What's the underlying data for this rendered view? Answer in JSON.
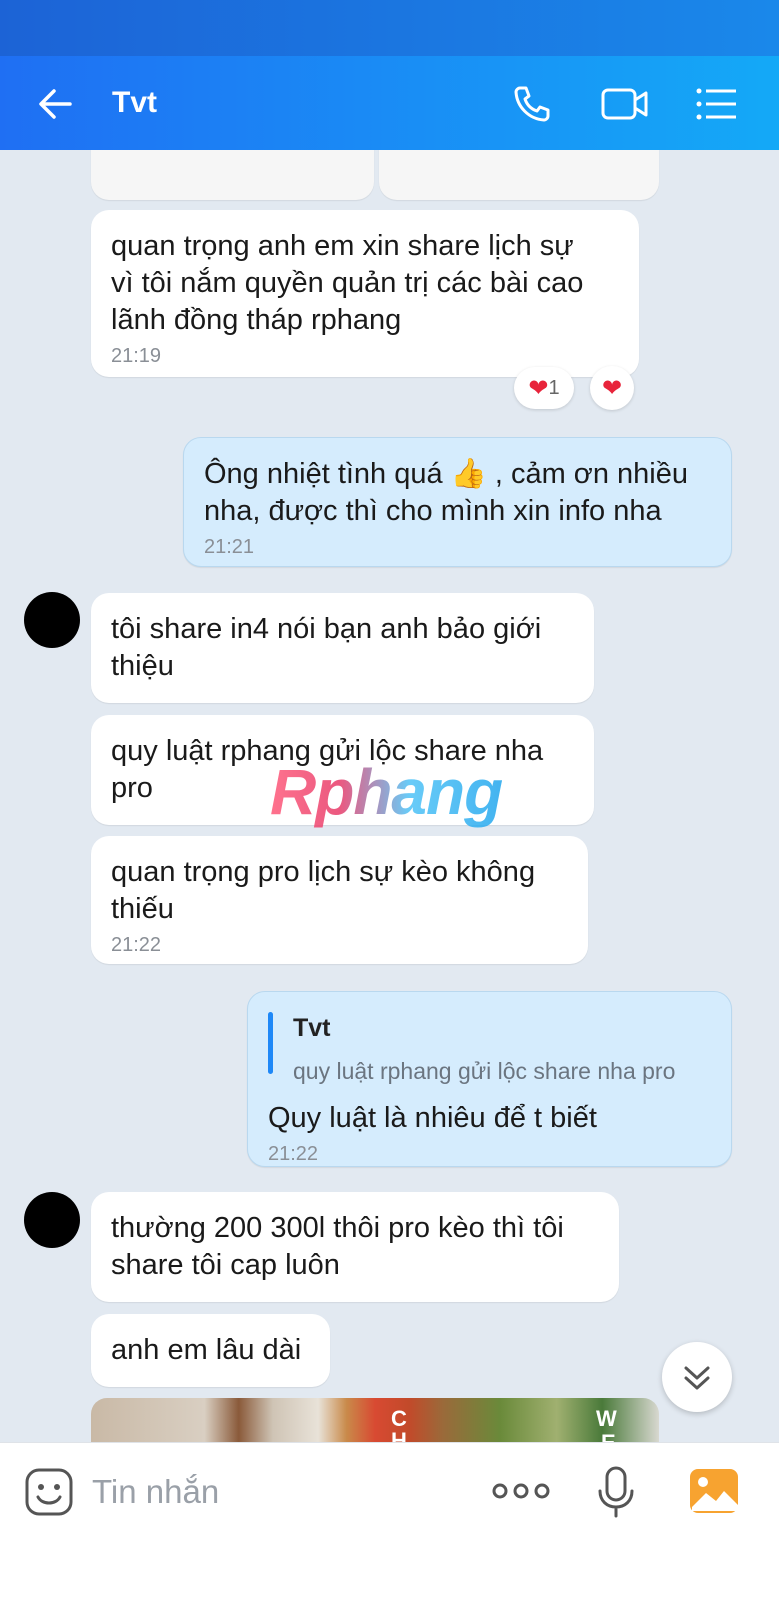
{
  "header": {
    "title": "Tvt"
  },
  "messages": [
    {
      "text": "quan trọng anh em xin share lịch sự\nvì tôi nắm quyền quản trị các bài cao\nlãnh đồng tháp rphang",
      "time": "21:19"
    },
    {
      "text": "Ông nhiệt tình quá 👍 , cảm ơn nhiều\nnha, được thì cho mình xin info nha",
      "time": "21:21"
    },
    {
      "text": "tôi share in4 nói bạn anh bảo giới\nthiệu"
    },
    {
      "text": "quy luật rphang gửi lộc share nha\npro"
    },
    {
      "text": "quan trọng pro lịch sự kèo không\nthiếu",
      "time": "21:22"
    },
    {
      "quote_name": "Tvt",
      "quote_text": "quy luật rphang gửi lộc share nha pro",
      "text": "Quy luật là nhiêu để t biết",
      "time": "21:22"
    },
    {
      "text": "thường 200 300l thôi pro kèo thì tôi\nshare tôi cap luôn"
    },
    {
      "text": "anh em lâu dài"
    }
  ],
  "reactions": {
    "heart_count": "1"
  },
  "watermark": "Rphang",
  "photo_letters": [
    "C",
    "H",
    "W",
    "E"
  ],
  "input": {
    "placeholder": "Tin nhắn"
  }
}
